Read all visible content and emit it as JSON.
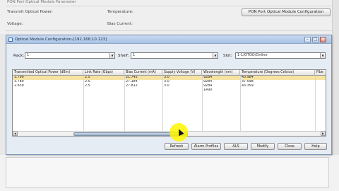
{
  "background": {
    "section_title": "PON Port Optical Module Parameter",
    "transmit_label": "Transmit Optical Power:",
    "temperature_label": "Temperature:",
    "voltage_label": "Voltage:",
    "bias_label": "Bias Current:",
    "config_button": "PON Port Optical Module Configuration"
  },
  "dialog": {
    "title": "Optical Module Configuration-[192.168.10.123]",
    "rack_label": "Rack:",
    "rack_value": "1",
    "shelf_label": "Shelf:",
    "shelf_value": "1",
    "slot_label": "Slot:",
    "slot_value": "1-1/OTOO/Online",
    "table": {
      "columns": [
        "Transmitted Optical Power (dBm)",
        "Link Rate (Gbps)",
        "Bias Current (mA)",
        "Supply Voltage (V)",
        "Wavelength (nm)",
        "Temperature (Degrees Celsius)",
        "Fibe"
      ],
      "rows": [
        [
          "3.799",
          "2.5",
          "21.742",
          "3.0",
          "9284",
          "40.984",
          ""
        ],
        [
          "3.789",
          "2.5",
          "27.184",
          "3.0",
          "9284",
          "37.598",
          ""
        ],
        [
          "2.659",
          "2.5",
          "27.812",
          "3.0",
          "9284",
          "43.359",
          ""
        ],
        [
          "",
          "",
          "",
          "",
          "1490",
          "",
          ""
        ]
      ],
      "selected_row": 0
    },
    "buttons": {
      "refresh": "Refresh",
      "alarm_profiles": "Alarm Profiles",
      "alt": "ALS",
      "modify": "Modify",
      "close": "Close",
      "help": "Help"
    }
  },
  "colors": {
    "selected_row": "#f6e3a3",
    "titlebar": "#b9cfec",
    "highlight": "#fff600"
  }
}
